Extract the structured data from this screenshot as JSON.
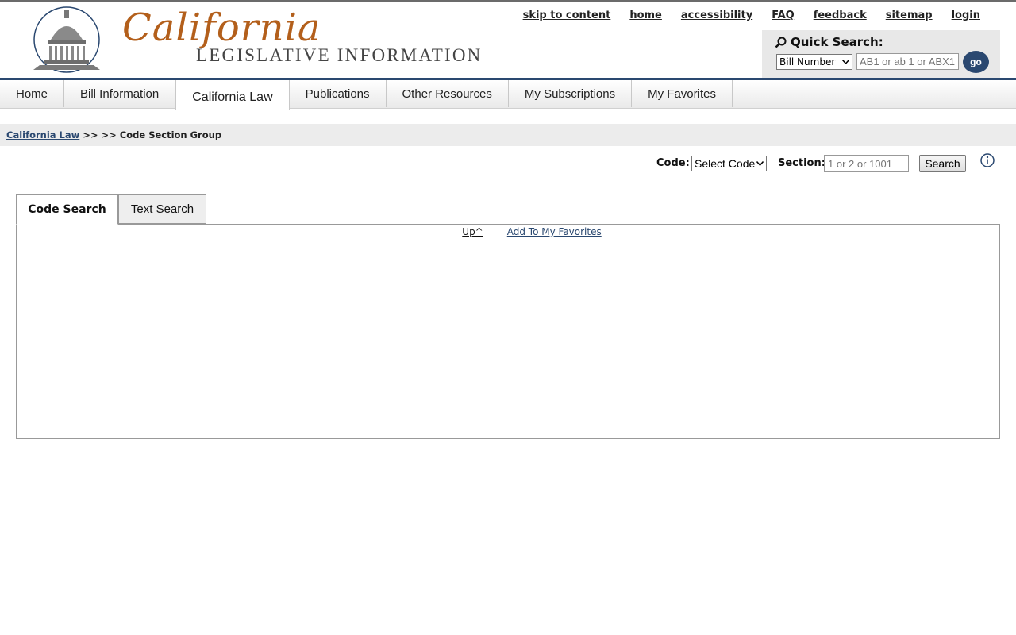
{
  "logo": {
    "script_text": "California",
    "subtitle": "LEGISLATIVE INFORMATION"
  },
  "utility_links": [
    "skip to content",
    "home",
    "accessibility",
    "FAQ",
    "feedback",
    "sitemap",
    "login"
  ],
  "quick_search": {
    "title": "Quick Search:",
    "type_selected": "Bill Number",
    "input_placeholder": "AB1 or ab 1 or ABX1",
    "go_label": "go"
  },
  "nav": {
    "items": [
      "Home",
      "Bill Information",
      "California Law",
      "Publications",
      "Other Resources",
      "My Subscriptions",
      "My Favorites"
    ],
    "active": "California Law"
  },
  "breadcrumb": {
    "link": "California Law",
    "separator": ">> >>",
    "current": "Code Section Group"
  },
  "code_search": {
    "code_label": "Code:",
    "code_selected": "Select Code",
    "section_label": "Section:",
    "section_placeholder": "1 or 2 or 1001",
    "search_label": "Search"
  },
  "tabs": [
    "Code Search",
    "Text Search"
  ],
  "content": {
    "up_label": "Up^",
    "favorites_label": "Add To My Favorites"
  },
  "colors": {
    "brand_orange": "#b35f1b",
    "nav_blue": "#2a4870",
    "breadcrumb_bg": "#ececec"
  }
}
